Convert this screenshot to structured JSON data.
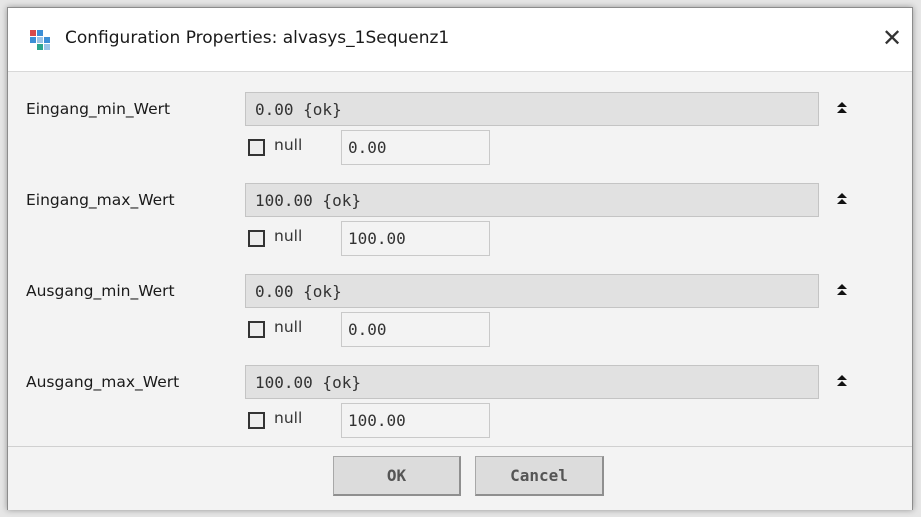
{
  "window": {
    "title": "Configuration Properties: alvasys_1Sequenz1",
    "close_glyph": "✕"
  },
  "properties": [
    {
      "label": "Eingang_min_Wert",
      "value": "0.00 {ok}",
      "null_label": "null",
      "null_checked": false,
      "null_value": "0.00"
    },
    {
      "label": "Eingang_max_Wert",
      "value": "100.00 {ok}",
      "null_label": "null",
      "null_checked": false,
      "null_value": "100.00"
    },
    {
      "label": "Ausgang_min_Wert",
      "value": "0.00 {ok}",
      "null_label": "null",
      "null_checked": false,
      "null_value": "0.00"
    },
    {
      "label": "Ausgang_max_Wert",
      "value": "100.00 {ok}",
      "null_label": "null",
      "null_checked": false,
      "null_value": "100.00"
    }
  ],
  "buttons": {
    "ok_label": "OK",
    "cancel_label": "Cancel"
  },
  "icons": {
    "app": "config-app-icon",
    "collapse": "double-chevron-up-icon",
    "close": "close-icon"
  },
  "colors": {
    "value_field_bg": "#e1e1e1",
    "content_bg": "#f3f3f3",
    "button_bg": "#dcdcdc"
  }
}
